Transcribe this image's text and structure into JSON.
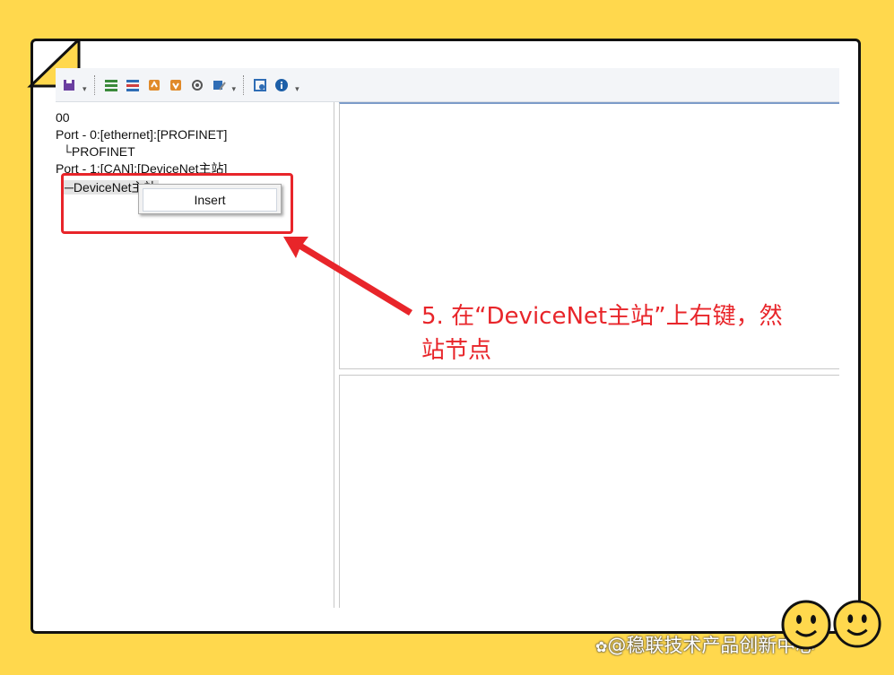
{
  "toolbar": {
    "icons": [
      "save-icon",
      "add-device-icon",
      "remove-device-icon",
      "upload-icon",
      "download-icon",
      "settings-icon",
      "edit-icon",
      "config-icon",
      "info-icon"
    ]
  },
  "tree": {
    "root": "00",
    "port0": "Port - 0:[ethernet]:[PROFINET]",
    "port0_child": "└PROFINET",
    "port1": "Port - 1:[CAN]:[DeviceNet主站]",
    "port1_child": "─DeviceNet主站"
  },
  "context_menu": {
    "insert_label": "Insert"
  },
  "annotation": {
    "line1": "5. 在“DeviceNet主站”上右键，然",
    "line2": "站节点"
  },
  "watermark": "@稳联技术产品创新中心",
  "colors": {
    "background": "#FFD84D",
    "highlight": "#E8252A",
    "panel_accent": "#7C9CC9"
  }
}
